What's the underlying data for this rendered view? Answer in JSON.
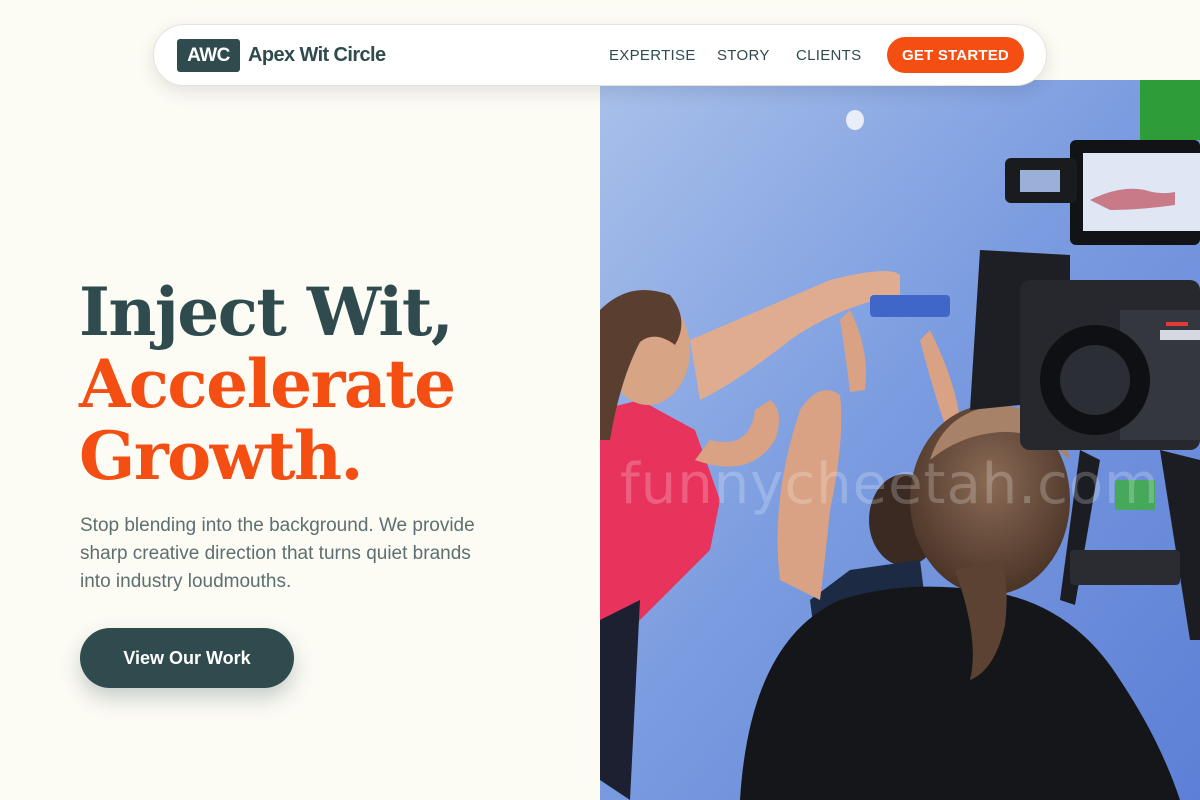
{
  "brand": {
    "logo_mark": "AWC",
    "name": "Apex Wit Circle"
  },
  "nav": {
    "links": [
      "EXPERTISE",
      "STORY",
      "CLIENTS"
    ],
    "cta_label": "GET STARTED"
  },
  "hero": {
    "headline_line1": "Inject Wit,",
    "headline_line2": "Accelerate",
    "headline_line3": "Growth.",
    "subtext": "Stop blending into the background. We provide sharp creative direction that turns quiet brands into industry loudmouths.",
    "button_label": "View Our Work",
    "image_watermark": "funnycheetah.com"
  },
  "colors": {
    "background": "#fcfbf4",
    "primary_dark": "#2f4b4e",
    "accent_orange": "#f44e12"
  }
}
